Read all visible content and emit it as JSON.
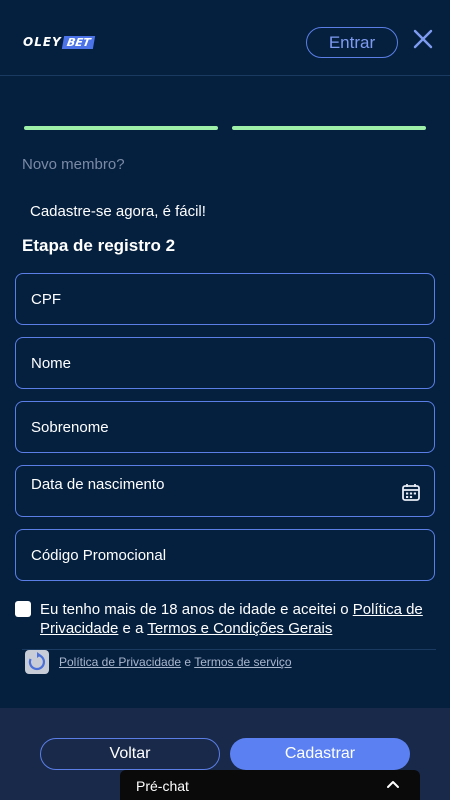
{
  "header": {
    "logo_left": "OLEY",
    "logo_right": "BET",
    "login_label": "Entrar"
  },
  "progress": {
    "current_step": 2,
    "total_steps": 2
  },
  "intro": {
    "new_member": "Novo membro?",
    "signup_easy": "Cadastre-se agora, é fácil!",
    "step_title": "Etapa de registro 2"
  },
  "form": {
    "cpf": "CPF",
    "nome": "Nome",
    "sobrenome": "Sobrenome",
    "nascimento": "Data de nascimento",
    "promo": "Código Promocional"
  },
  "terms": {
    "text_before": "Eu tenho mais de 18 anos de idade e aceitei o ",
    "privacy_link": "Política de Privacidade",
    "text_middle": " e a ",
    "terms_link": "Termos e Condições Gerais"
  },
  "recaptcha": {
    "privacy": "Política de Privacidade",
    "and": " e ",
    "terms": "Termos de serviço"
  },
  "footer": {
    "back_label": "Voltar",
    "submit_label": "Cadastrar"
  },
  "chat": {
    "label": "Pré-chat"
  },
  "colors": {
    "background": "#05203f",
    "accent": "#5b80f2",
    "progress": "#9ef0a8",
    "footer": "#19294a"
  }
}
